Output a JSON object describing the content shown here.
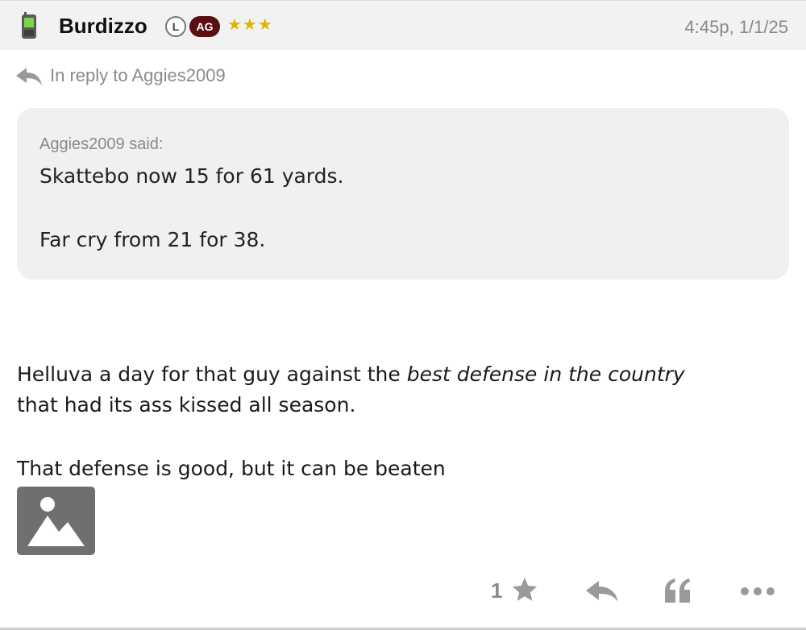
{
  "header": {
    "author": "Burdizzo",
    "badge_l": "L",
    "badge_ag": "AG",
    "stars": "★★★",
    "timestamp": "4:45p, 1/1/25",
    "icons": [
      "phone-icon"
    ]
  },
  "reply": {
    "text": "In reply to Aggies2009",
    "icon": "reply-arrow-icon"
  },
  "quote": {
    "author_line": "Aggies2009 said:",
    "lines": [
      "Skattebo now 15 for 61 yards.",
      "Far cry from 21 for 38."
    ]
  },
  "body": {
    "line1_before": "Helluva a day for that guy against the ",
    "line1_italic": "best defense in the country",
    "line2": "that had its ass kissed all season.",
    "line3": "That defense is good, but it can be beaten",
    "image_icon": "image-placeholder-icon"
  },
  "footer": {
    "like_count": "1",
    "icons": [
      "star-icon",
      "reply-icon",
      "quote-icon",
      "more-icon"
    ]
  },
  "colors": {
    "header_bg": "#f2f2f2",
    "quote_bg": "#f0f0f0",
    "badge_ag_bg": "#5a0e14",
    "stars": "#e2b400",
    "muted_text": "#888888"
  }
}
